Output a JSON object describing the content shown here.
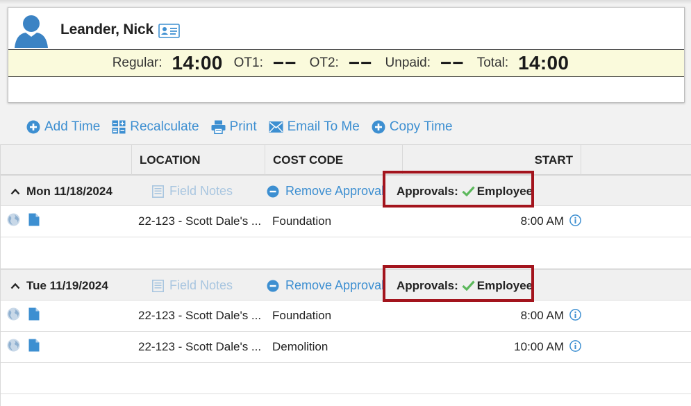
{
  "employee": {
    "name": "Leander, Nick"
  },
  "totals": {
    "regular_label": "Regular:",
    "regular_value": "14:00",
    "ot1_label": "OT1:",
    "ot1_value": "−−",
    "ot2_label": "OT2:",
    "ot2_value": "−−",
    "unpaid_label": "Unpaid:",
    "unpaid_value": "−−",
    "total_label": "Total:",
    "total_value": "14:00"
  },
  "toolbar": {
    "add_time": "Add Time",
    "recalculate": "Recalculate",
    "print": "Print",
    "email": "Email To Me",
    "copy_time": "Copy Time"
  },
  "columns": {
    "location": "LOCATION",
    "cost_code": "COST CODE",
    "start": "START"
  },
  "groups": [
    {
      "date": "Mon 11/18/2024",
      "field_notes": "Field Notes",
      "remove_approval": "Remove Approval",
      "approvals_label": "Approvals:",
      "approvals_value": "Employee",
      "entries": [
        {
          "location": "22-123 - Scott Dale's ...",
          "cost_code": "Foundation",
          "start": "8:00 AM"
        }
      ]
    },
    {
      "date": "Tue 11/19/2024",
      "field_notes": "Field Notes",
      "remove_approval": "Remove Approval",
      "approvals_label": "Approvals:",
      "approvals_value": "Employee",
      "entries": [
        {
          "location": "22-123 - Scott Dale's ...",
          "cost_code": "Foundation",
          "start": "8:00 AM"
        },
        {
          "location": "22-123 - Scott Dale's ...",
          "cost_code": "Demolition",
          "start": "10:00 AM"
        }
      ]
    }
  ],
  "colors": {
    "accent": "#3d8fd1",
    "highlight": "#a3141d",
    "totals_bg": "#fafadc",
    "check": "#5cb85c"
  },
  "icons": [
    "user-avatar-icon",
    "contact-card-icon",
    "plus-circle-icon",
    "calculator-icon",
    "printer-icon",
    "envelope-icon",
    "chevron-up-icon",
    "notes-icon",
    "minus-circle-icon",
    "checkmark-icon",
    "globe-icon",
    "document-icon",
    "info-icon"
  ]
}
